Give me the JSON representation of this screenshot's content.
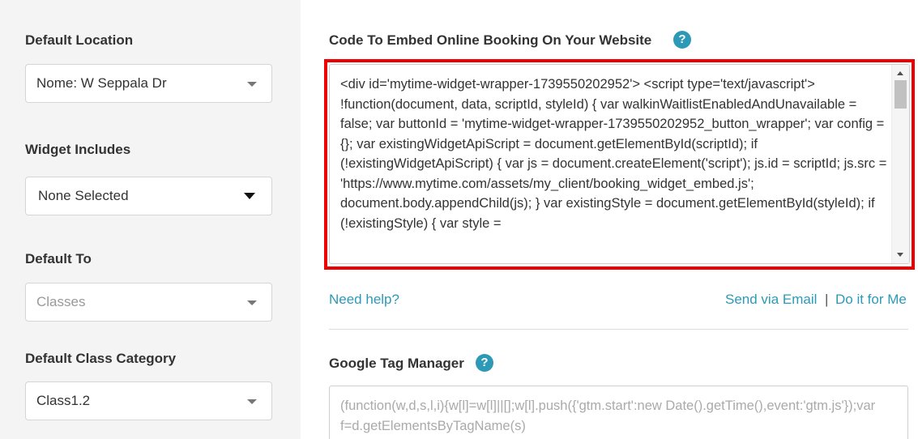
{
  "sidebar": {
    "default_location": {
      "label": "Default Location",
      "value": "Nome: W Seppala Dr"
    },
    "widget_includes": {
      "label": "Widget Includes",
      "value": "None Selected"
    },
    "default_to": {
      "label": "Default To",
      "placeholder": "Classes"
    },
    "default_class_category": {
      "label": "Default Class Category",
      "value": "Class1.2"
    }
  },
  "embed": {
    "title": "Code To Embed Online Booking On Your Website",
    "code": "<div id='mytime-widget-wrapper-1739550202952'> <script type='text/javascript'> !function(document, data, scriptId, styleId) { var walkinWaitlistEnabledAndUnavailable = false; var buttonId = 'mytime-widget-wrapper-1739550202952_button_wrapper';  var config = {}; var existingWidgetApiScript = document.getElementById(scriptId); if (!existingWidgetApiScript) { var js = document.createElement('script'); js.id = scriptId; js.src = 'https://www.mytime.com/assets/my_client/booking_widget_embed.js'; document.body.appendChild(js); } var existingStyle = document.getElementById(styleId); if (!existingStyle) { var style =",
    "need_help": "Need help?",
    "send_email": "Send via Email",
    "separator": "|",
    "do_it_for_me": "Do it for Me"
  },
  "gtm": {
    "title": "Google Tag Manager",
    "placeholder": "(function(w,d,s,l,i){w[l]=w[l]||[];w[l].push({'gtm.start':new Date().getTime(),event:'gtm.js'});var f=d.getElementsByTagName(s)"
  },
  "icons": {
    "help": "?"
  },
  "colors": {
    "accent": "#2c9ab7",
    "highlight": "#ee0000"
  }
}
